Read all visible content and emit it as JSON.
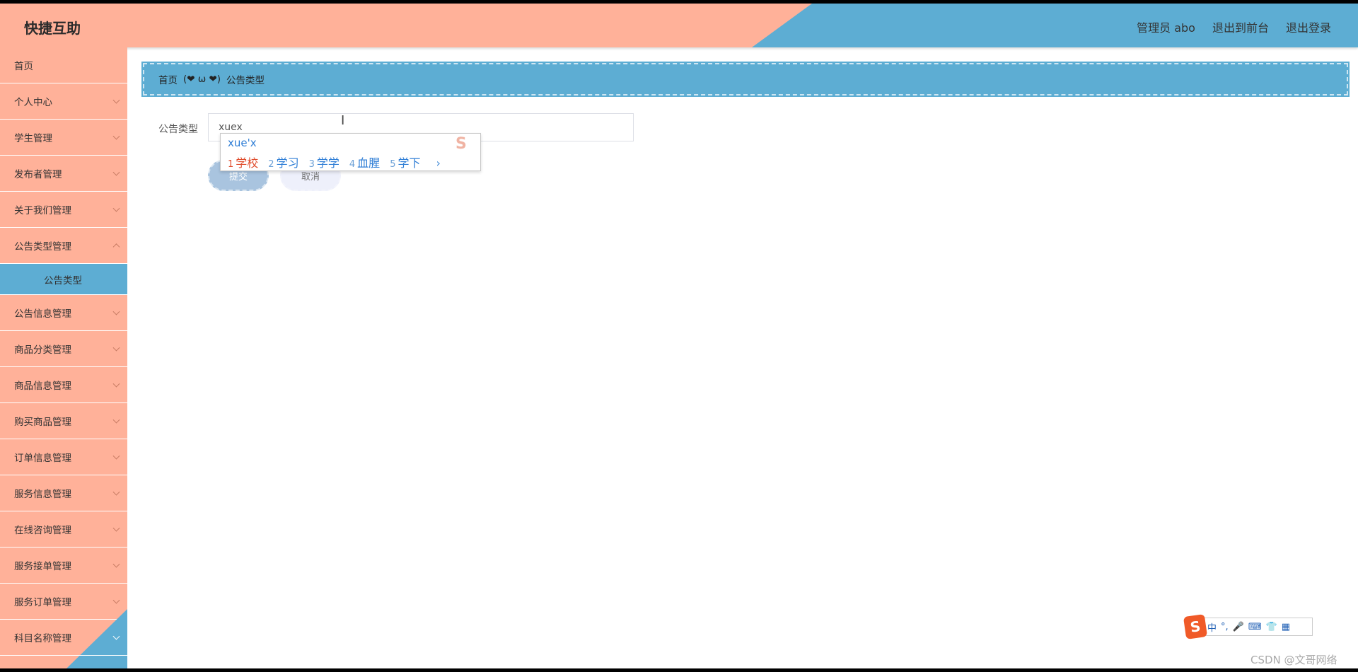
{
  "header": {
    "title": "快捷互助",
    "admin": "管理员 abo",
    "to_front": "退出到前台",
    "logout": "退出登录"
  },
  "sidebar": {
    "items": [
      {
        "label": "首页",
        "chevron": false
      },
      {
        "label": "个人中心",
        "chevron": true
      },
      {
        "label": "学生管理",
        "chevron": true
      },
      {
        "label": "发布者管理",
        "chevron": true
      },
      {
        "label": "关于我们管理",
        "chevron": true
      },
      {
        "label": "公告类型管理",
        "chevron": true
      }
    ],
    "active_sub": "公告类型",
    "items_after": [
      {
        "label": "公告信息管理"
      },
      {
        "label": "商品分类管理"
      },
      {
        "label": "商品信息管理"
      },
      {
        "label": "购买商品管理"
      },
      {
        "label": "订单信息管理"
      },
      {
        "label": "服务信息管理"
      },
      {
        "label": "在线咨询管理"
      },
      {
        "label": "服务接单管理"
      },
      {
        "label": "服务订单管理"
      },
      {
        "label": "科目名称管理"
      }
    ]
  },
  "breadcrumb": {
    "home": "首页",
    "separator": "(❤ ω ❤)",
    "current": "公告类型"
  },
  "form": {
    "label": "公告类型",
    "value": "xuex",
    "submit": "提交",
    "cancel": "取消"
  },
  "ime": {
    "composition": "xue'x",
    "logo": "S",
    "candidates": [
      {
        "index": "1",
        "text": "学校"
      },
      {
        "index": "2",
        "text": "学习"
      },
      {
        "index": "3",
        "text": "学学"
      },
      {
        "index": "4",
        "text": "血腥"
      },
      {
        "index": "5",
        "text": "学下"
      }
    ],
    "next": "›"
  },
  "ime_toolbar": {
    "logo": "S",
    "mode": "中",
    "punct": "°,",
    "mic": "🎤",
    "keyboard": "⌨",
    "skin": "👕",
    "grid": "▦"
  },
  "watermark": "CSDN @文哥网络",
  "colors": {
    "salmon": "#ffb199",
    "blue": "#5dadd3"
  }
}
